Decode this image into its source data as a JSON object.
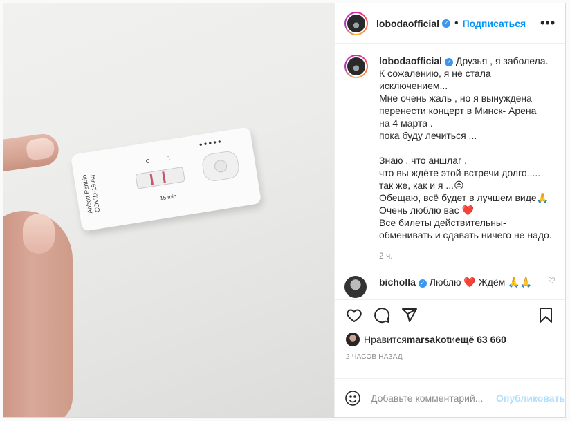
{
  "header": {
    "username": "lobodaofficial",
    "separator": "•",
    "follow_label": "Подписаться",
    "more_icon": "more-horizontal-icon"
  },
  "caption": {
    "username": "lobodaofficial",
    "lines": [
      "Друзья , я заболела.",
      "К сожалению, я не стала",
      "исключением...",
      "Мне очень жаль , но я вынуждена",
      "перенести концерт в Минск- Арена",
      "на 4 марта .",
      "пока буду лечиться ...",
      "",
      "Знаю , что аншлаг ,",
      "что вы ждёте этой встречи долго.....",
      "так же, как и я ...😔",
      "Обещаю, всё будет в лучшем виде🙏",
      "Очень люблю вас ❤️",
      "Все билеты действительны-",
      "обменивать и сдавать ничего не надо."
    ],
    "time": "2 ч."
  },
  "comment": {
    "username": "bicholla",
    "text": "Люблю ❤️ Ждём 🙏🙏"
  },
  "actions": {
    "like_icon": "heart-outline-icon",
    "comment_icon": "comment-bubble-icon",
    "share_icon": "paper-plane-icon",
    "save_icon": "bookmark-icon"
  },
  "likes": {
    "prefix": "Нравится ",
    "user": "marsakot",
    "conjunction": " и ",
    "others": "ещё 63 660"
  },
  "post_time": "2 ЧАСОВ НАЗАД",
  "add_comment": {
    "emoji_icon": "smiley-icon",
    "placeholder": "Добавьте комментарий...",
    "publish_label": "Опубликовать"
  },
  "media": {
    "test_brand": "Abbott Panbio COVID-19 Ag",
    "test_ct": "C T",
    "test_duration": "15 min",
    "colors": {
      "background": "#ececea",
      "result_line": "#c8546a"
    }
  },
  "colors": {
    "accent": "#0095f6",
    "accent_disabled": "#b2dffc",
    "text": "#262626",
    "secondary": "#8e8e8e",
    "border": "#dbdbdb",
    "verified": "#3897f0",
    "heart": "#ed4956"
  }
}
